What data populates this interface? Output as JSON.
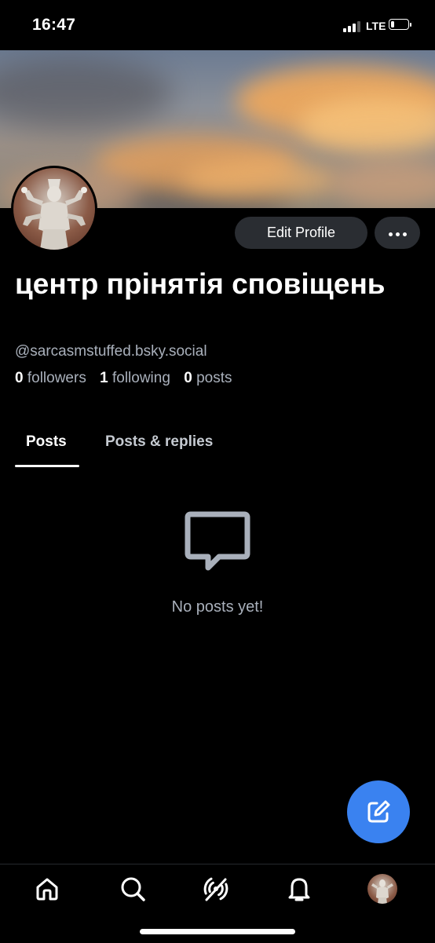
{
  "status_bar": {
    "time": "16:47",
    "network": "LTE",
    "battery_level": 0.2
  },
  "profile": {
    "display_name": "центр прінятія сповіщень",
    "handle": "@sarcasmstuffed.bsky.social",
    "followers_count": "0",
    "followers_label": "followers",
    "following_count": "1",
    "following_label": "following",
    "posts_count": "0",
    "posts_label": "posts"
  },
  "actions": {
    "edit_profile": "Edit Profile"
  },
  "tabs": [
    {
      "label": "Posts",
      "active": true
    },
    {
      "label": "Posts & replies",
      "active": false
    }
  ],
  "empty_state": {
    "text": "No posts yet!",
    "icon": "message-square-icon"
  },
  "fab": {
    "icon": "compose-icon"
  },
  "bottom_nav": [
    {
      "name": "home",
      "icon": "home-icon"
    },
    {
      "name": "search",
      "icon": "search-icon"
    },
    {
      "name": "feeds",
      "icon": "feeds-icon"
    },
    {
      "name": "notifications",
      "icon": "bell-icon"
    },
    {
      "name": "profile",
      "icon": "avatar"
    }
  ],
  "colors": {
    "accent": "#3a82f0",
    "muted_text": "#a9b0bb",
    "button_bg": "#2a2d32",
    "background": "#000000"
  }
}
